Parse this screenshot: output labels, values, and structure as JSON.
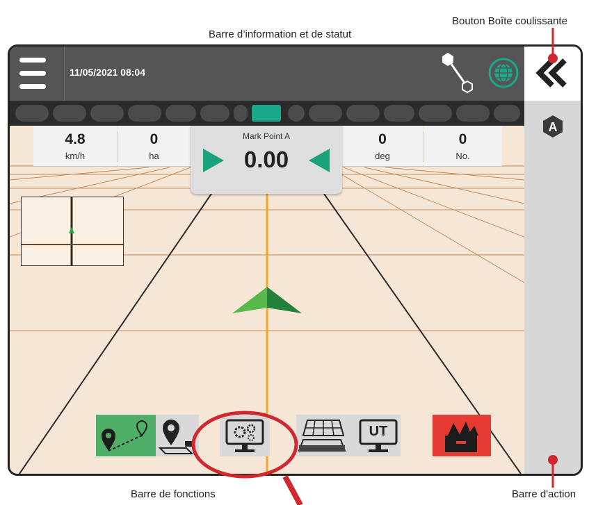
{
  "callouts": {
    "slide_box_button": "Bouton Boîte coulissante",
    "info_status_bar": "Barre d’information et de statut",
    "function_bar": "Barre de fonctions",
    "action_bar": "Barre d'action"
  },
  "header": {
    "datetime": "11/05/2021 08:04",
    "menu_icon": "hamburger-icon",
    "boundary_icon": "boundary-point-icon",
    "gnss_icon": "gnss-status-globe-icon"
  },
  "section_bar": {
    "segments": 16,
    "active_segment": 7
  },
  "stats": {
    "speed": {
      "value": "4.8",
      "unit": "km/h"
    },
    "area": {
      "value": "0",
      "unit": "ha"
    },
    "heading": {
      "value": "0",
      "unit": "deg"
    },
    "count": {
      "value": "0",
      "unit": "No."
    }
  },
  "cross_track": {
    "label": "Mark Point A",
    "value": "0.00"
  },
  "side_panel": {
    "slide_icon": "double-chevron-left-icon",
    "badge_letter": "A"
  },
  "function_bar": {
    "buttons": [
      "guidance-mode-icon",
      "field-location-icon",
      "system-setup-icon",
      "implement-map-icon",
      "universal-terminal-icon",
      "data-tools-icon"
    ],
    "ut_label": "UT"
  },
  "colors": {
    "accent_green": "#19a98a",
    "guidance_line": "#f5a623",
    "vehicle_green": "#2e9e4a",
    "field_bg": "#f5e6d6",
    "header_gray": "#555555",
    "highlight_red": "#d0282e"
  }
}
